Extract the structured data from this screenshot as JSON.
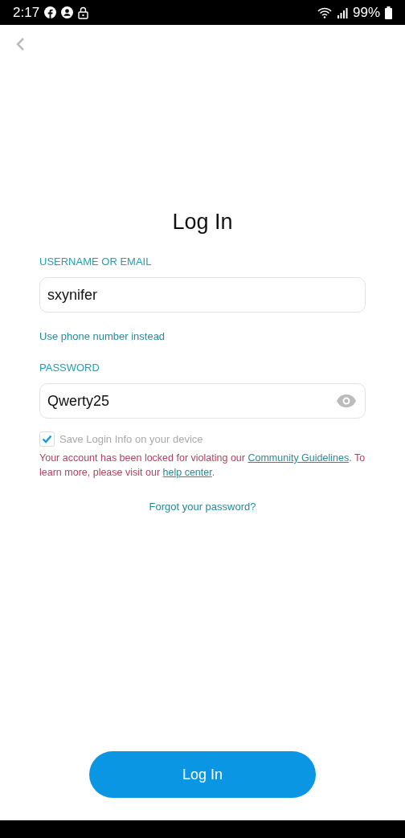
{
  "status_bar": {
    "time": "2:17",
    "battery": "99%"
  },
  "title": "Log In",
  "username": {
    "label": "USERNAME OR EMAIL",
    "value": "sxynifer"
  },
  "alt_link": "Use phone number instead",
  "password": {
    "label": "PASSWORD",
    "value": "Qwerty25"
  },
  "save_login": {
    "label": "Save Login Info on your device",
    "checked": true
  },
  "error": {
    "before": "Your account has been locked for violating our ",
    "link_1": "Community Guidelines",
    "middle": ". To learn more, please visit our ",
    "link_2": "help center",
    "after": "."
  },
  "forgot": "Forgot your password?",
  "submit": "Log In"
}
